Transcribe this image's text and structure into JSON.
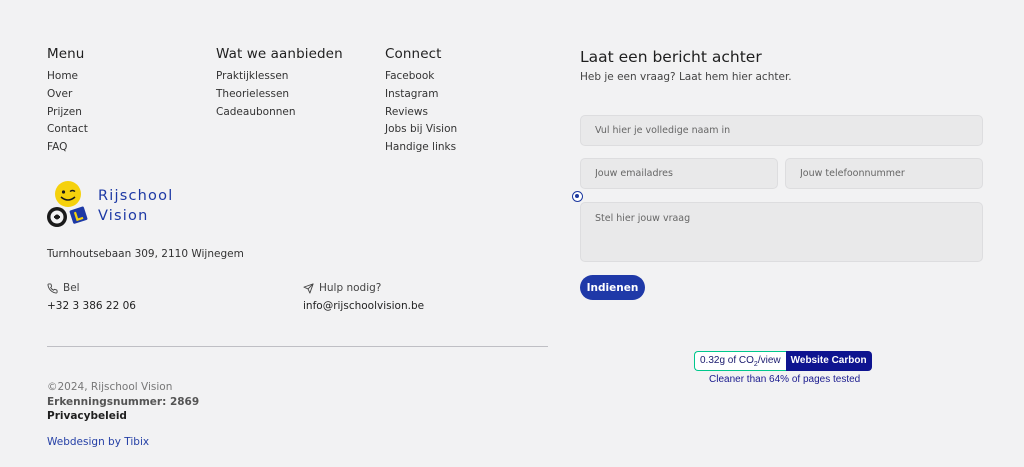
{
  "footer": {
    "menu": {
      "heading": "Menu",
      "links": [
        "Home",
        "Over",
        "Prijzen",
        "Contact",
        "FAQ"
      ]
    },
    "offer": {
      "heading": "Wat we aanbieden",
      "links": [
        "Praktijklessen",
        "Theorielessen",
        "Cadeaubonnen"
      ]
    },
    "connect": {
      "heading": "Connect",
      "links": [
        "Facebook",
        "Instagram",
        "Reviews",
        "Jobs bij Vision",
        "Handige links"
      ]
    },
    "logo": {
      "line1": "Rijschool",
      "line2": "Vision"
    },
    "address": "Turnhoutsebaan 309, 2110 Wijnegem",
    "phone": {
      "label": "Bel",
      "value": "+32 3 386 22 06"
    },
    "mail": {
      "label": "Hulp nodig?",
      "value": "info@rijschoolvision.be"
    },
    "legal": {
      "copyright": "©2024, Rijschool Vision",
      "registration": "Erkenningsnummer: 2869",
      "privacy": "Privacybeleid"
    },
    "credit": "Webdesign by Tibix"
  },
  "form": {
    "title": "Laat een bericht achter",
    "subtitle": "Heb je een vraag? Laat hem hier achter.",
    "name_placeholder": "Vul hier je volledige naam in",
    "email_placeholder": "Jouw emailadres",
    "phone_placeholder": "Jouw telefoonnummer",
    "question_placeholder": "Stel hier jouw vraag",
    "submit_label": "Indienen"
  },
  "carbon": {
    "amount": "0.32g of CO",
    "amount_sub": "2",
    "amount_suffix": "/view",
    "brand": "Website Carbon",
    "comparison": "Cleaner than 64% of pages tested"
  },
  "colors": {
    "brand": "#1f39a8",
    "background": "#f2f2f3",
    "carbon_border": "#00c78c",
    "carbon_badge": "#0e1490"
  },
  "icons": [
    "phone-icon",
    "send-icon",
    "logo-smiley-icon"
  ]
}
